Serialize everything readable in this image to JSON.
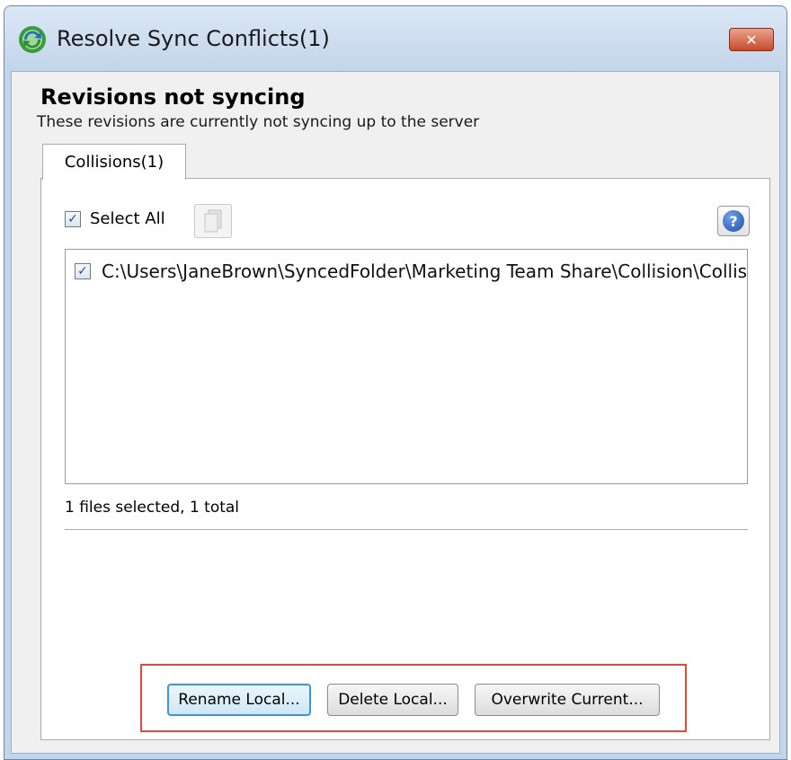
{
  "window": {
    "title": "Resolve Sync Conflicts(1)",
    "close_symbol": "✕",
    "app_icon": "sync-icon"
  },
  "header": {
    "title": "Revisions not syncing",
    "subtitle": "These revisions are currently not syncing up to the server"
  },
  "tabs": [
    {
      "label": "Collisions(1)",
      "active": true
    }
  ],
  "toolbar": {
    "select_all_label": "Select All",
    "select_all_checked": true,
    "files_icon": "files-icon",
    "help_icon": "help-icon",
    "help_symbol": "?"
  },
  "list": {
    "items": [
      {
        "checked": true,
        "path": "C:\\Users\\JaneBrown\\SyncedFolder\\Marketing Team Share\\Collision\\Collision Test.docx"
      }
    ]
  },
  "status": {
    "text": "1 files selected, 1 total"
  },
  "actions": {
    "rename_label": "Rename Local...",
    "delete_label": "Delete Local...",
    "overwrite_label": "Overwrite Current..."
  },
  "colors": {
    "highlight_border": "#e8473a",
    "default_button_border": "#3d95d6",
    "checkmark": "#1d4fa0"
  },
  "check_symbol": "✓"
}
